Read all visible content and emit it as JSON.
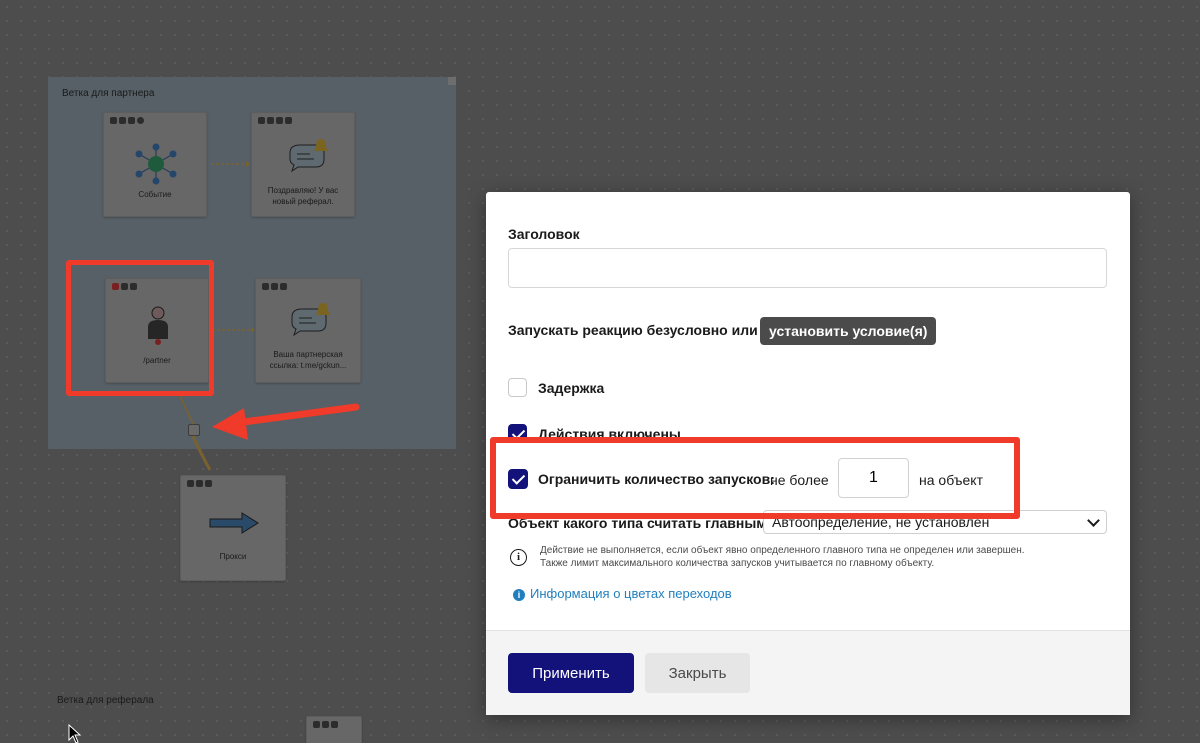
{
  "canvas": {
    "partner_branch_label": "Ветка для партнера",
    "referral_branch_label": "Ветка для реферала",
    "nodes": {
      "event": {
        "title": "Событие"
      },
      "congrats": {
        "title": "Поздравляю! У вас новый реферал."
      },
      "partner_cmd": {
        "title": "/partner"
      },
      "partner_link": {
        "title": "Ваша партнерская ссылка: t.me/gckun..."
      },
      "proxy": {
        "title": "Прокси"
      }
    }
  },
  "modal": {
    "title_label": "Заголовок",
    "title_value": "",
    "condition_label": "Запускать реакцию безусловно или",
    "condition_button": "установить условие(я)",
    "delay": {
      "label": "Задержка",
      "checked": false
    },
    "actions_enabled": {
      "label": "Действия включены",
      "checked": true
    },
    "limit": {
      "label": "Ограничить количество запусков:",
      "checked": true,
      "prefix": "не более",
      "value": "1",
      "suffix": "на объект"
    },
    "object_type": {
      "label": "Объект какого типа считать главным:",
      "selected": "Автоопределение, не установлен"
    },
    "note_line1": "Действие не выполняется, если объект явно определенного главного типа не определен или завершен.",
    "note_line2": "Также лимит максимального количества запусков учитывается по главному объекту.",
    "info_link": "Информация о цветах переходов",
    "apply_button": "Применить",
    "close_button": "Закрыть"
  },
  "colors": {
    "primary": "#12127a",
    "highlight": "#f03a2a",
    "link": "#1f7fbf"
  }
}
